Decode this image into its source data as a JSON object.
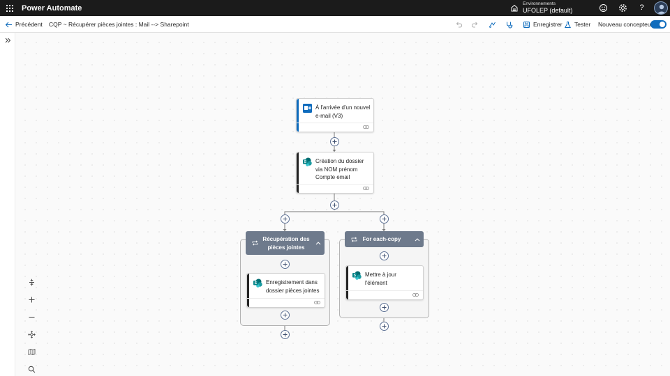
{
  "topbar": {
    "app_title": "Power Automate",
    "environment_label": "Environnements",
    "environment_name": "UFOLEP (default)",
    "icons": [
      "waffle-icon",
      "environment-icon",
      "feedback-icon",
      "settings-icon",
      "help-icon",
      "avatar"
    ]
  },
  "cmdbar": {
    "back_label": "Précédent",
    "flow_name": "CQP ~ Récupérer pièces jointes : Mail --> Sharepoint",
    "save_label": "Enregistrer",
    "test_label": "Tester",
    "new_designer_label": "Nouveau concepteur",
    "new_designer_enabled": true
  },
  "flow": {
    "trigger": {
      "title_line1": "À l'arrivée d'un nouvel",
      "title_line2": "e-mail (V3)",
      "connector": "outlook"
    },
    "action_create_folder": {
      "title_line1": "Création du dossier",
      "title_line2": "via NOM prénom",
      "title_line3": "Compte email",
      "connector": "sharepoint"
    },
    "scope_attachments": {
      "title_line1": "Récupération des",
      "title_line2": "pièces jointes",
      "inner_action": {
        "title_line1": "Enregistrement dans",
        "title_line2": "dossier pièces jointes",
        "connector": "sharepoint"
      }
    },
    "scope_foreach": {
      "title": "For each-copy",
      "inner_action": {
        "title_line1": "Mettre à jour",
        "title_line2": "l'élément",
        "connector": "sharepoint"
      }
    }
  },
  "zoom_controls": [
    "fit-view-icon",
    "zoom-in-icon",
    "zoom-out-icon",
    "pan-icon",
    "minimap-icon",
    "search-icon"
  ],
  "colors": {
    "topbar": "#1b1b1b",
    "accent_blue": "#0f6cbd",
    "scope_header": "#6e7a8c",
    "outlook": "#0f6cbd",
    "sharepoint": "#036c70"
  }
}
